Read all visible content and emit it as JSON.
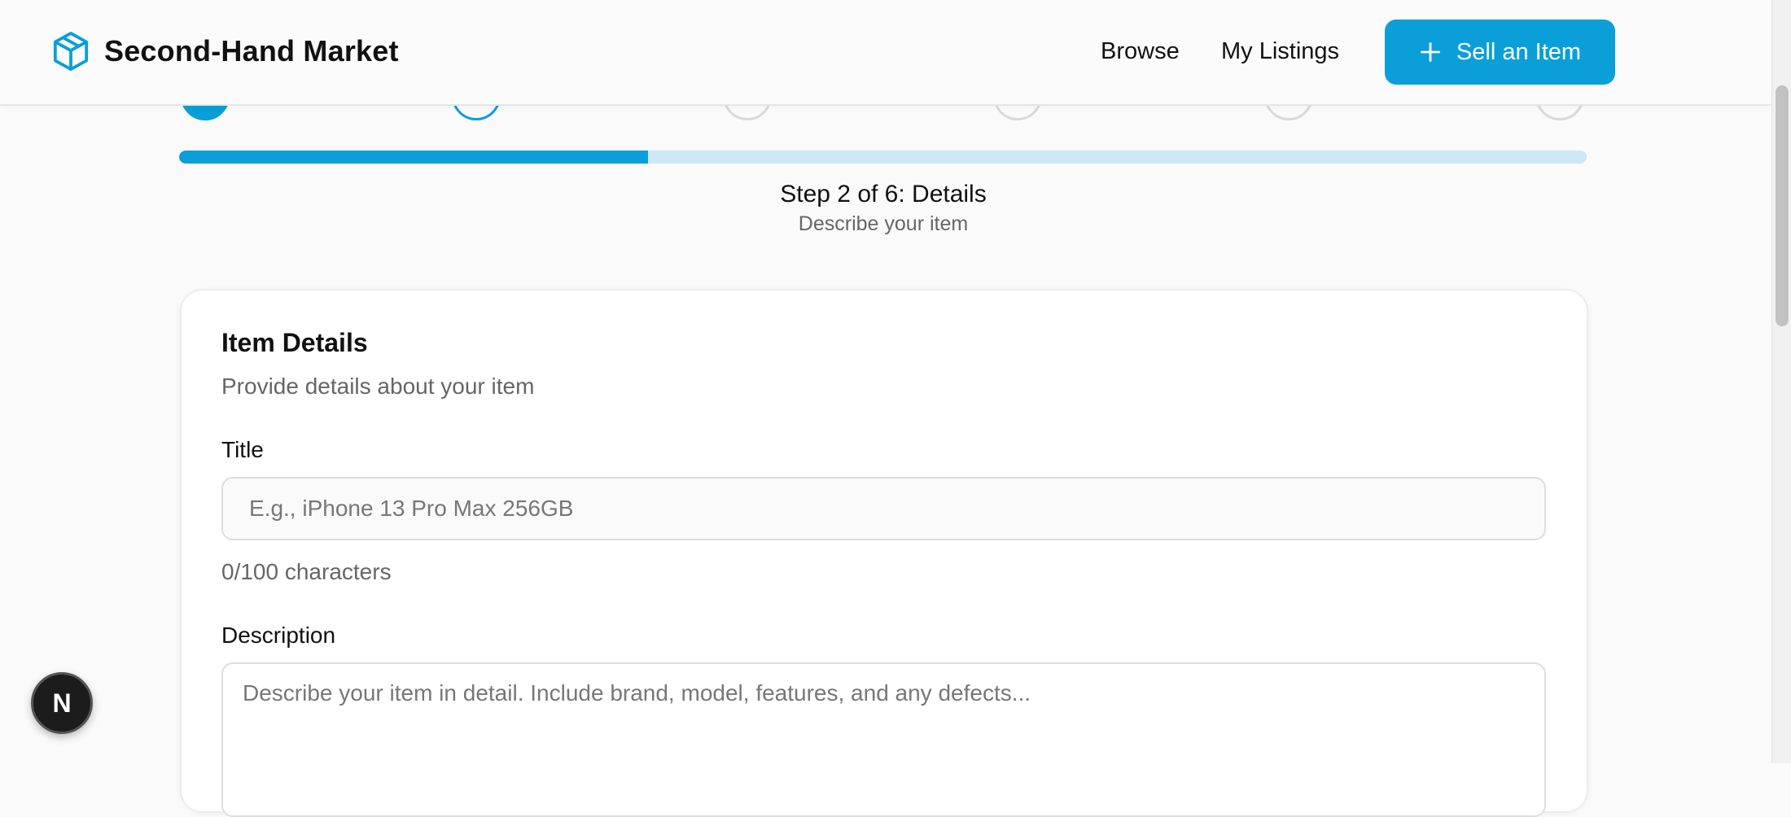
{
  "header": {
    "brand": "Second-Hand Market",
    "nav": {
      "browse": "Browse",
      "my_listings": "My Listings"
    },
    "sell_button": "Sell an Item"
  },
  "stepper": {
    "current_step": 2,
    "total_steps": 6,
    "progress_percent": 33.3,
    "title": "Step 2 of 6: Details",
    "subtitle": "Describe your item"
  },
  "card": {
    "title": "Item Details",
    "subtitle": "Provide details about your item",
    "title_field": {
      "label": "Title",
      "placeholder": "E.g., iPhone 13 Pro Max 256GB",
      "value": "",
      "char_count": "0/100 characters"
    },
    "description_field": {
      "label": "Description",
      "placeholder": "Describe your item in detail. Include brand, model, features, and any defects...",
      "value": ""
    }
  },
  "dev_badge": "N",
  "colors": {
    "accent": "#0a9fd9",
    "track": "#cde9f6"
  }
}
